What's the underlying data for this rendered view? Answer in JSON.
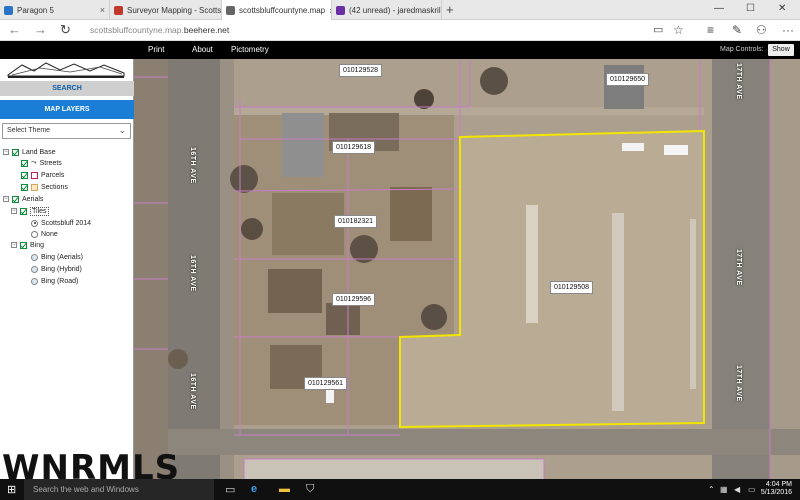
{
  "browser": {
    "tabs": [
      {
        "title": "Paragon 5",
        "color": "#2b73c4"
      },
      {
        "title": "Surveyor Mapping - Scotts",
        "color": "#c0392b"
      },
      {
        "title": "scottsbluffcountyne.map",
        "color": "#444"
      },
      {
        "title": "(42 unread) - jaredmaskrill",
        "color": "#6a2fa3"
      }
    ],
    "new_tab_icon": "plus-icon",
    "url_host": "scottsbluffcountyne.map.",
    "url_domain": "beehere.net"
  },
  "app_menu": {
    "items": [
      "Print",
      "About",
      "Pictometry"
    ],
    "map_controls_label": "Map Controls:",
    "show_button": "Show"
  },
  "sidebar": {
    "search_label": "SEARCH",
    "layers_label": "MAP LAYERS",
    "theme_placeholder": "Select Theme",
    "tree": {
      "land_base": "Land Base",
      "streets": "Streets",
      "parcels": "Parcels",
      "sections": "Sections",
      "aerials": "Aerials",
      "tiles": "Tiles",
      "scottsbluff": "Scottsbluff 2014",
      "none": "None",
      "bing": "Bing",
      "bing_aerials": "Bing (Aerials)",
      "bing_hybrid": "Bing (Hybrid)",
      "bing_road": "Bing (Road)"
    }
  },
  "map": {
    "parcels": [
      "010129528",
      "010129650",
      "010129618",
      "010182321",
      "010129508",
      "010129596",
      "010129561"
    ],
    "streets": [
      "16TH AVE",
      "16TH AVE",
      "16TH AVE",
      "17TH AVE",
      "17TH AVE",
      "17TH AVE"
    ],
    "selection_color": "#f2e600",
    "parcel_line_color": "#c77dc7"
  },
  "watermark": "WNRMLS",
  "taskbar": {
    "search_placeholder": "Search the web and Windows",
    "time": "4:04 PM",
    "date": "5/13/2016"
  }
}
